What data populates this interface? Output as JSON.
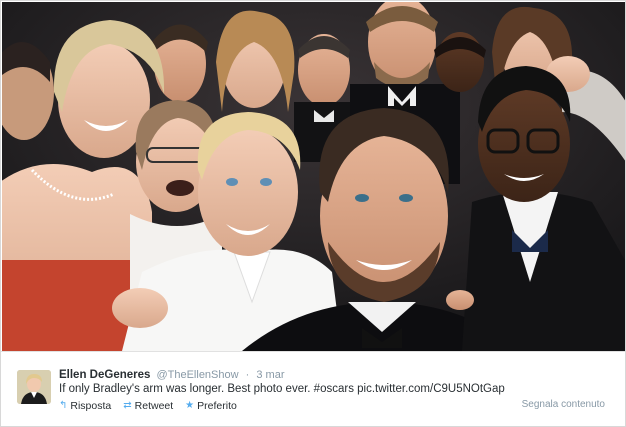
{
  "tweet": {
    "name": "Ellen DeGeneres",
    "handle": "@TheEllenShow",
    "separator": "·",
    "date": "3 mar",
    "text": "If only Bradley's arm was longer. Best photo ever. #oscars pic.twitter.com/C9U5NOtGap",
    "actions": {
      "reply": "Risposta",
      "retweet": "Retweet",
      "favorite": "Preferito"
    },
    "report": "Segnala contenuto"
  },
  "icons": {
    "reply": "reply-icon",
    "retweet": "retweet-icon",
    "favorite": "star-icon"
  },
  "colors": {
    "accent": "#55acee",
    "name_text": "#292f33",
    "meta_text": "#8899a6"
  }
}
